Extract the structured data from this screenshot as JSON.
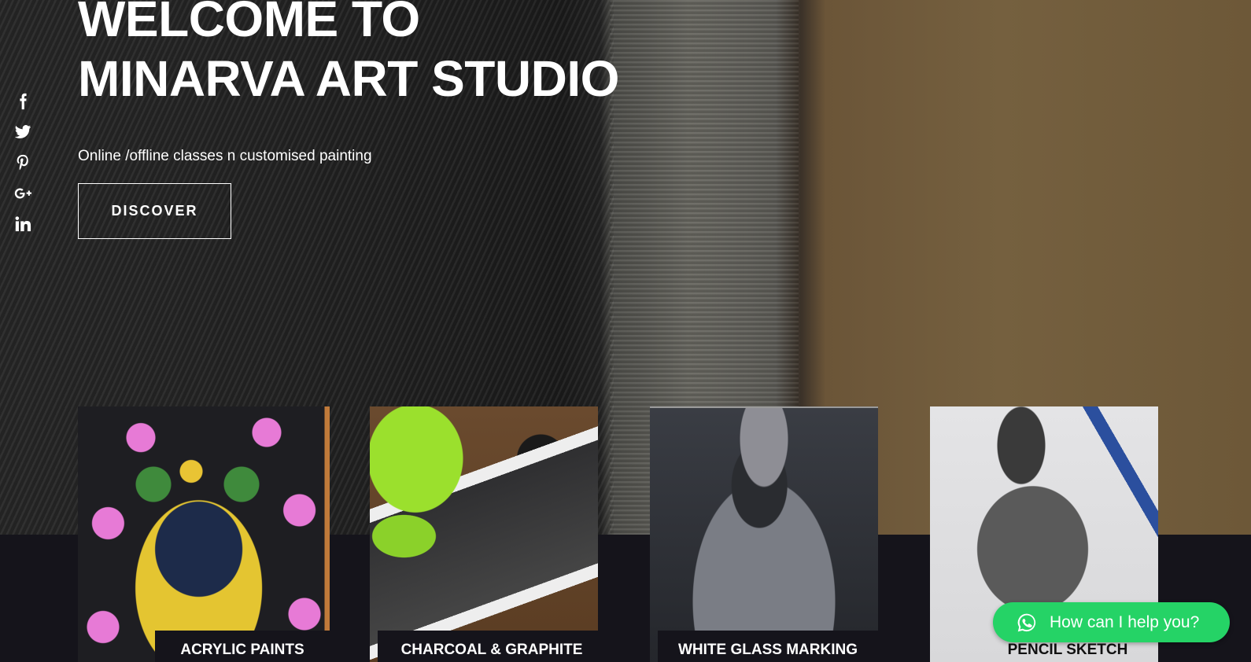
{
  "hero": {
    "title_line1": "WELCOME TO",
    "title_line2": "MINARVA ART STUDIO",
    "subtitle": "Online /offline classes n customised painting",
    "cta_label": "DISCOVER"
  },
  "social": [
    {
      "icon": "facebook-icon"
    },
    {
      "icon": "twitter-icon"
    },
    {
      "icon": "pinterest-icon"
    },
    {
      "icon": "google-plus-icon"
    },
    {
      "icon": "linkedin-icon"
    }
  ],
  "cards": [
    {
      "label": "ACRYLIC PAINTS"
    },
    {
      "label": "CHARCOAL & GRAPHITE"
    },
    {
      "label": "WHITE GLASS MARKING"
    },
    {
      "label": "PENCIL SKETCH"
    }
  ],
  "chat": {
    "label": "How can I help you?",
    "icon": "whatsapp-icon",
    "color": "#25d366"
  }
}
